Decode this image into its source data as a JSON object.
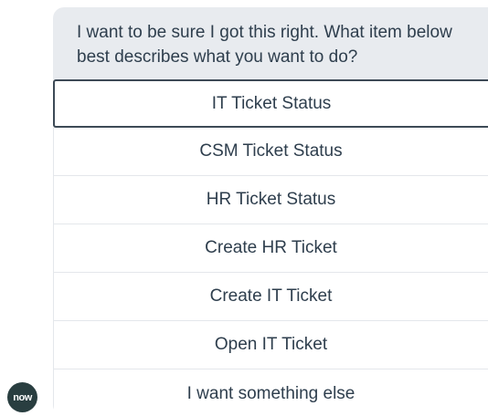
{
  "bot": {
    "avatar_text": "now",
    "message": "I want to be sure I got this right. What item below best describes what you want to do?"
  },
  "options": [
    {
      "label": "IT Ticket Status",
      "selected": true
    },
    {
      "label": "CSM Ticket Status",
      "selected": false
    },
    {
      "label": "HR Ticket Status",
      "selected": false
    },
    {
      "label": "Create HR Ticket",
      "selected": false
    },
    {
      "label": "Create IT Ticket",
      "selected": false
    },
    {
      "label": "Open IT Ticket",
      "selected": false
    },
    {
      "label": "I want something else",
      "selected": false
    }
  ],
  "colors": {
    "message_bg": "#e8ebef",
    "text": "#2e3e4d",
    "selected_border": "#3d4a56",
    "avatar_bg": "#293e40"
  }
}
